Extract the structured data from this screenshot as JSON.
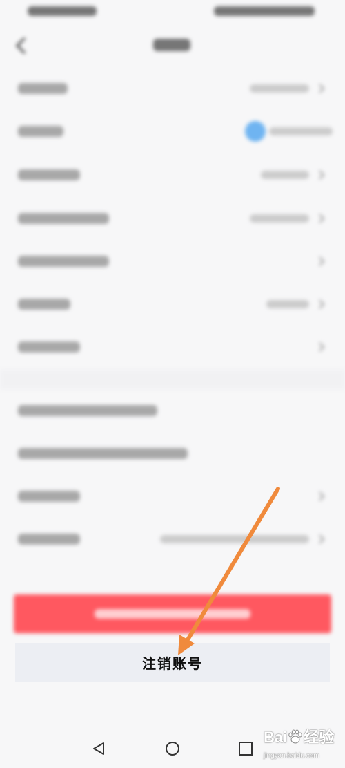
{
  "status_bar": {
    "icons": [
      "status-left-icons",
      "status-right-icons"
    ]
  },
  "header": {
    "back_icon": "chevron-left-icon"
  },
  "settings_rows": {
    "chevron_icon": "chevron-right-icon",
    "avatar_color": "#6fb4f1"
  },
  "logout_button": {
    "color": "#ff5860"
  },
  "cancel_account_button": {
    "label": "注销账号",
    "background": "#eceef3"
  },
  "annotation": {
    "icon": "arrow-icon",
    "color": "#f08a3c"
  },
  "nav_bar": {
    "icons": [
      "back-triangle-icon",
      "home-circle-icon",
      "recents-square-icon"
    ]
  },
  "watermark": {
    "brand_prefix": "Bai",
    "logo_icon": "paw-icon",
    "brand_suffix": "经验",
    "url": "jingyan.baidu.com"
  }
}
